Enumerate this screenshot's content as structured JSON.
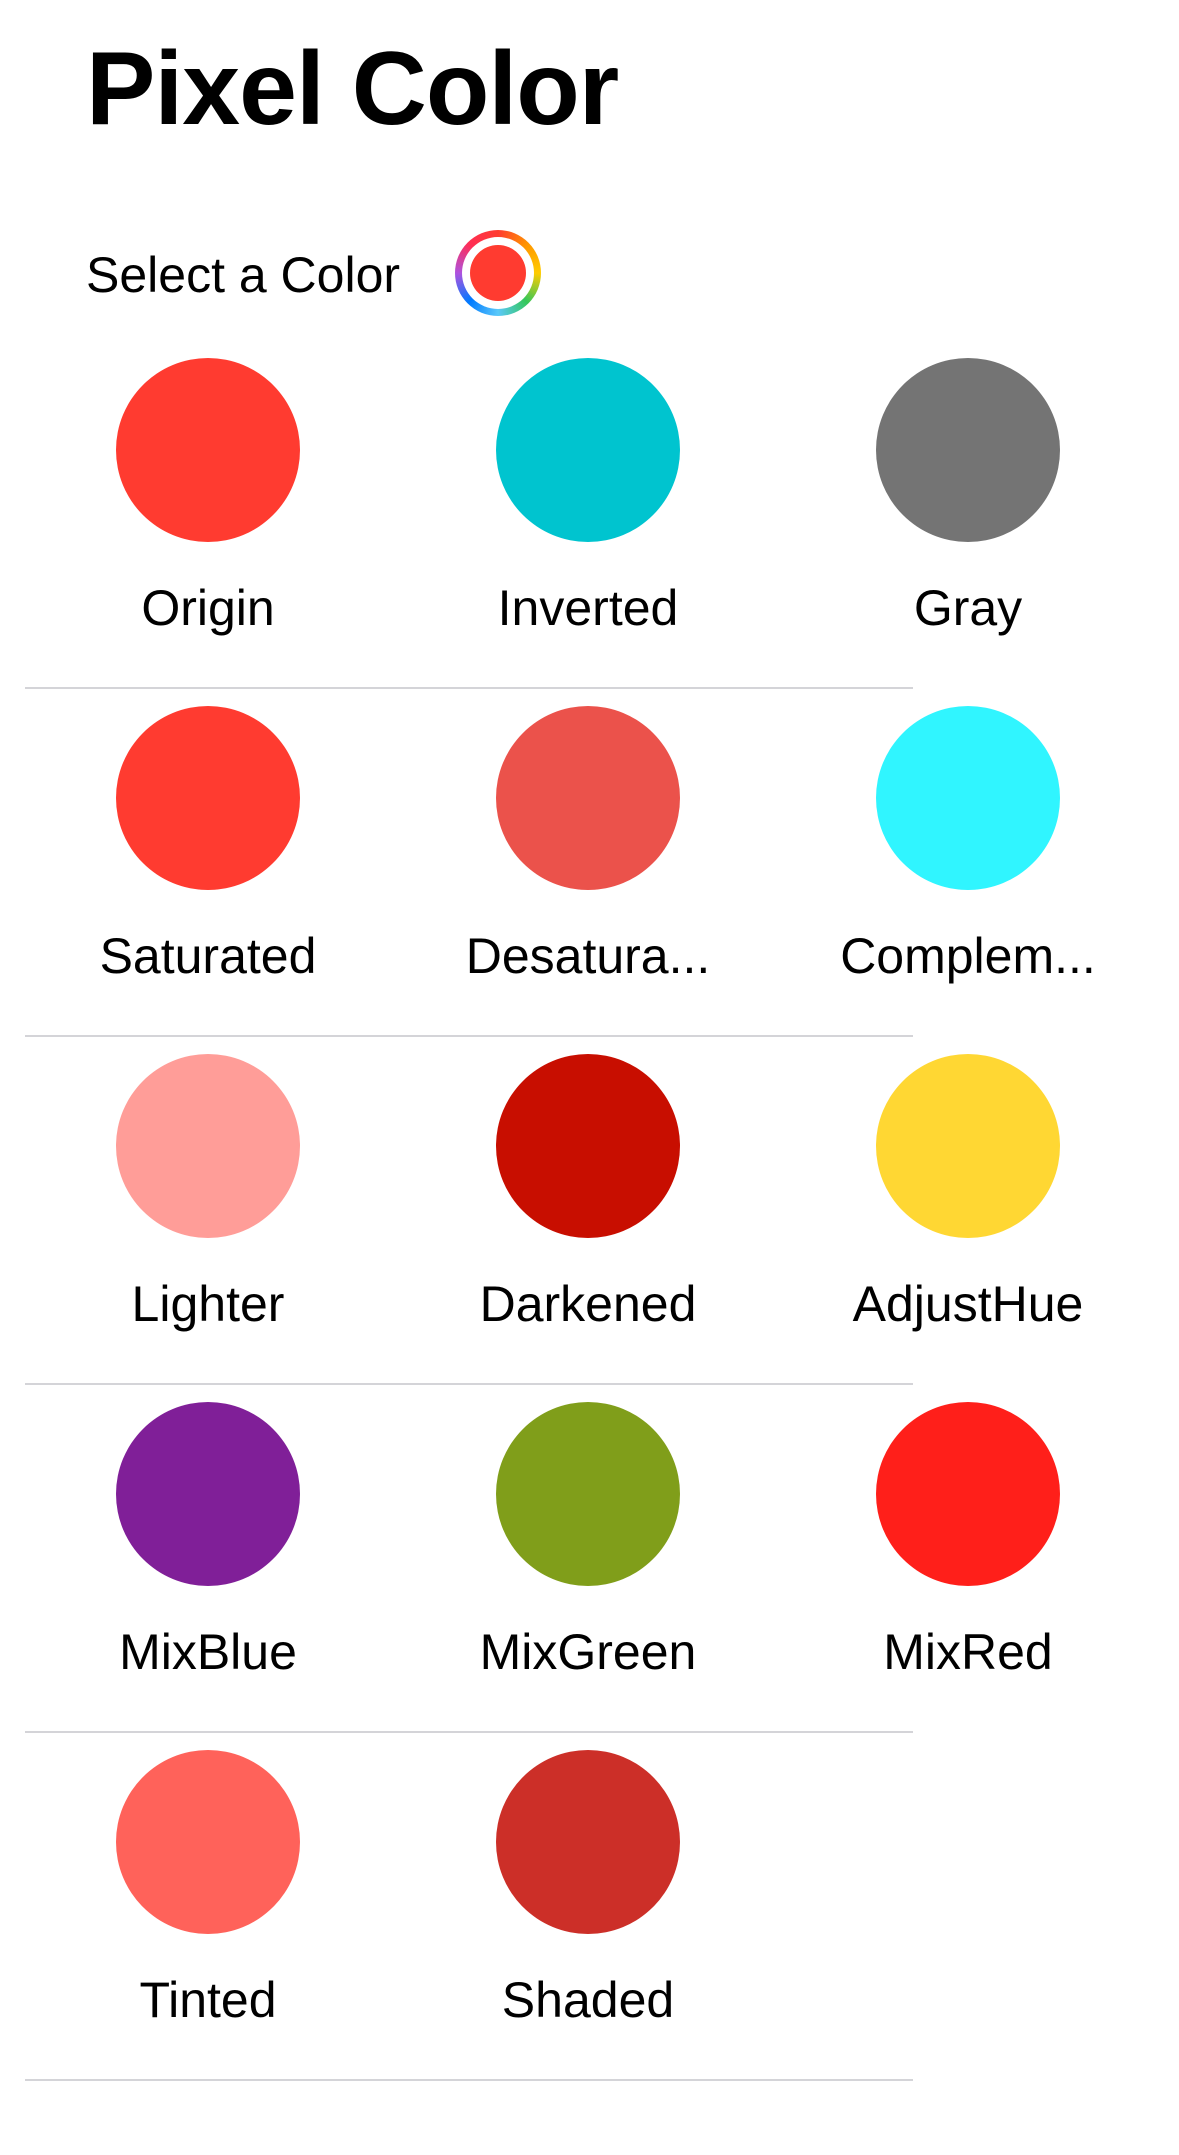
{
  "header": {
    "title": "Pixel Color"
  },
  "picker": {
    "label": "Select a Color",
    "selected_color": "#ff3b30"
  },
  "swatches": [
    [
      {
        "label": "Origin",
        "color": "#ff3b30"
      },
      {
        "label": "Inverted",
        "color": "#00c4cf"
      },
      {
        "label": "Gray",
        "color": "#747474"
      }
    ],
    [
      {
        "label": "Saturated",
        "color": "#ff3b30"
      },
      {
        "label": "Desatura...",
        "color": "#eb524b"
      },
      {
        "label": "Complem...",
        "color": "#30f5ff"
      }
    ],
    [
      {
        "label": "Lighter",
        "color": "#ff9d98"
      },
      {
        "label": "Darkened",
        "color": "#c80e00"
      },
      {
        "label": "AdjustHue",
        "color": "#ffd733"
      }
    ],
    [
      {
        "label": "MixBlue",
        "color": "#801f98"
      },
      {
        "label": "MixGreen",
        "color": "#809e1a"
      },
      {
        "label": "MixRed",
        "color": "#ff1f1a"
      }
    ],
    [
      {
        "label": "Tinted",
        "color": "#ff625a"
      },
      {
        "label": "Shaded",
        "color": "#cc2f28"
      }
    ]
  ]
}
